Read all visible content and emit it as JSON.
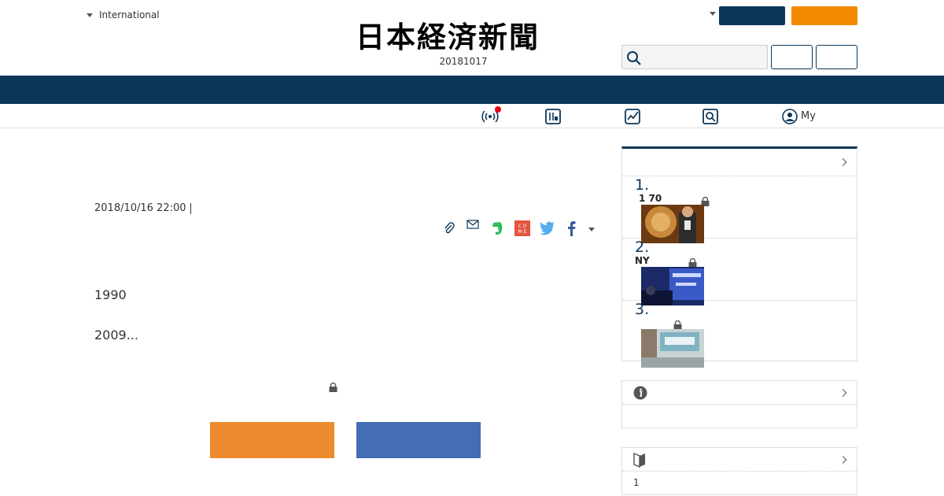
{
  "header": {
    "edition_label": "International",
    "logo_text": "日本経済新聞",
    "date": "20181017"
  },
  "subnav": {
    "my_label": "My"
  },
  "article": {
    "pub_date": "2018/10/16 22:00",
    "lines": [
      "1990",
      "2009..."
    ]
  },
  "sidebar": {
    "ranking": [
      {
        "num": "1.",
        "title": "1 70"
      },
      {
        "num": "2.",
        "title": "NY"
      },
      {
        "num": "3.",
        "title": ""
      }
    ],
    "box3_text": "1"
  },
  "colors": {
    "navy": "#0d3759",
    "orange": "#f28a00",
    "button_orange": "#ec8b2f",
    "button_blue": "#436eb3",
    "live_dot": "#e60012"
  },
  "icons": {
    "live": "live-broadcast-icon",
    "paper": "newspaper-icon",
    "market": "chart-icon",
    "search": "search-icon",
    "mypage": "user-icon"
  }
}
